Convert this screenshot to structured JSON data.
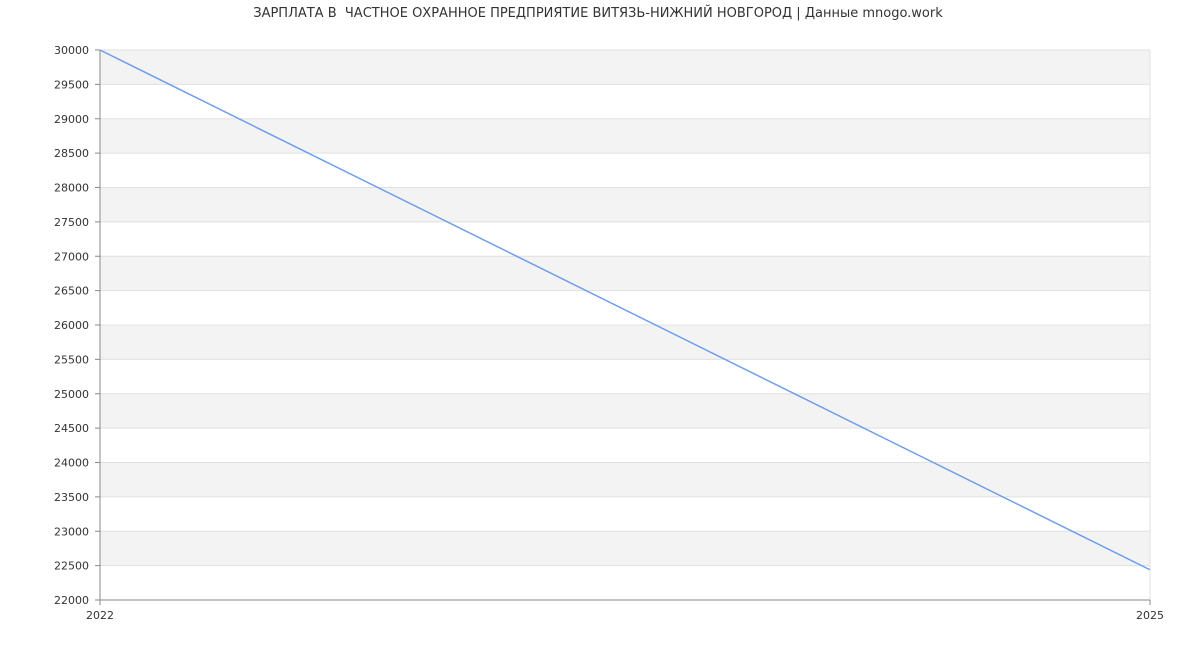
{
  "chart_data": {
    "type": "line",
    "title": "ЗАРПЛАТА В  ЧАСТНОЕ ОХРАННОЕ ПРЕДПРИЯТИЕ ВИТЯЗЬ-НИЖНИЙ НОВГОРОД | Данные mnogo.work",
    "xlabel": "",
    "ylabel": "",
    "x": [
      "2022",
      "2025"
    ],
    "series": [
      {
        "values": [
          30000,
          22440
        ],
        "color": "#6d9eeb"
      }
    ],
    "xlim": [
      2022,
      2025
    ],
    "ylim": [
      22000,
      30000
    ],
    "yticks": [
      30000,
      29500,
      29000,
      28500,
      28000,
      27500,
      27000,
      26500,
      26000,
      25500,
      25000,
      24500,
      24000,
      23500,
      23000,
      22500,
      22000
    ],
    "xticks": [
      "2022",
      "2025"
    ],
    "grid": true,
    "band_color": "#f3f3f3",
    "grid_color": "#e0e0e0",
    "axis_color": "#888888"
  }
}
